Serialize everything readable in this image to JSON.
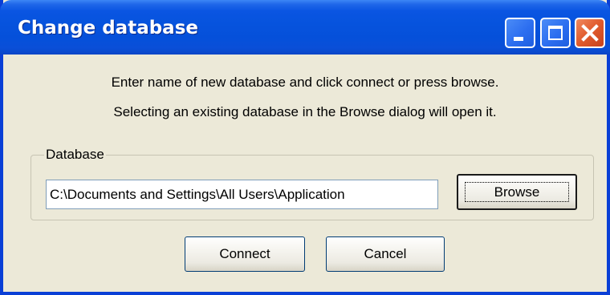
{
  "window": {
    "title": "Change database",
    "accent_color": "#0a55e2",
    "close_color": "#e05a2c",
    "background_color": "#ece9d8"
  },
  "titlebar_buttons": {
    "minimize_icon": "minimize-icon",
    "maximize_icon": "maximize-icon",
    "close_icon": "close-icon"
  },
  "message": {
    "line1": "Enter name of new database and click connect or press browse.",
    "line2": "Selecting an existing database in the Browse dialog will open it."
  },
  "database_group": {
    "label": "Database",
    "path_value": "C:\\Documents and Settings\\All Users\\Application",
    "browse_label": "Browse"
  },
  "actions": {
    "connect_label": "Connect",
    "cancel_label": "Cancel"
  }
}
